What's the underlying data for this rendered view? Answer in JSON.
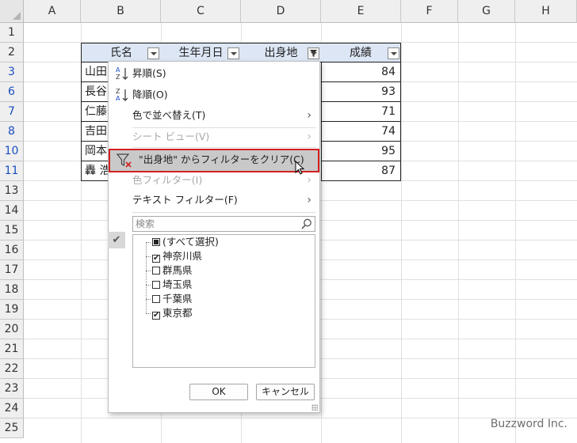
{
  "columns": [
    "A",
    "B",
    "C",
    "D",
    "E",
    "F",
    "G",
    "H"
  ],
  "rows": [
    "1",
    "2",
    "3",
    "6",
    "7",
    "8",
    "10",
    "11",
    "13",
    "14",
    "15",
    "16",
    "17",
    "18",
    "19",
    "20",
    "21",
    "22",
    "23",
    "24",
    "25"
  ],
  "table": {
    "headers": [
      "氏名",
      "生年月日",
      "出身地",
      "成績"
    ],
    "name_cells": [
      "山田",
      "長谷",
      "仁藤",
      "吉田",
      "岡本",
      "轟 浩"
    ],
    "score_cells": [
      "84",
      "93",
      "71",
      "74",
      "95",
      "87"
    ]
  },
  "menu": {
    "sort_asc": "昇順(S)",
    "sort_desc": "降順(O)",
    "sort_by_color": "色で並べ替え(T)",
    "sheet_view": "シート ビュー(V)",
    "clear_filter": "\"出身地\" からフィルターをクリア(C)",
    "color_filter": "色フィルター(I)",
    "text_filter": "テキスト フィルター(F)",
    "search_placeholder": "検索",
    "list_items": [
      {
        "label": "(すべて選択)",
        "state": "partial"
      },
      {
        "label": "神奈川県",
        "state": "checked"
      },
      {
        "label": "群馬県",
        "state": "unchecked"
      },
      {
        "label": "埼玉県",
        "state": "unchecked"
      },
      {
        "label": "千葉県",
        "state": "unchecked"
      },
      {
        "label": "東京都",
        "state": "checked"
      }
    ],
    "ok_label": "OK",
    "cancel_label": "キャンセル"
  },
  "icons": {
    "check": "✔",
    "arrow": "›"
  },
  "watermark": "Buzzword Inc.",
  "colors": {
    "header_fill": "#dce6f4",
    "highlight_outline": "#d32020",
    "filtered_row_number": "#1a4dbf"
  }
}
